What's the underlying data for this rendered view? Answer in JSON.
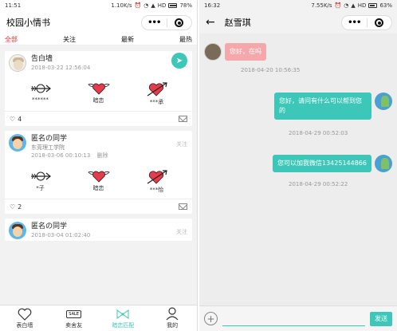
{
  "left": {
    "status": {
      "time": "11:51",
      "speed": "1.10K/s",
      "battery_text": "78%",
      "battery_level": 0.78,
      "network": "HD"
    },
    "title": "校园小情书",
    "tabs": [
      "全部",
      "关注",
      "最新",
      "最热"
    ],
    "cards": [
      {
        "poster": "告白墙",
        "school": "",
        "time": "2018-03-22 12:56:04",
        "delete_label": "",
        "follow_label": "关注",
        "choices": [
          {
            "icon": "arrow-heart-icon",
            "label": "******"
          },
          {
            "icon": "winged-heart-icon",
            "label": "暗恋"
          },
          {
            "icon": "arrow-pierced-heart-icon",
            "label": "***承"
          }
        ],
        "likes": "4"
      },
      {
        "poster": "匿名の同学",
        "school": "东莞理工学院",
        "time": "2018-03-06 00:10:13",
        "delete_label": "删除",
        "follow_label": "关注",
        "choices": [
          {
            "icon": "arrow-heart-icon",
            "label": "*子"
          },
          {
            "icon": "winged-heart-icon",
            "label": "暗恋"
          },
          {
            "icon": "arrow-pierced-heart-icon",
            "label": "***怡"
          }
        ],
        "likes": "2"
      },
      {
        "poster": "匿名の同学",
        "school": "",
        "time": "2018-03-04 01:02:40",
        "delete_label": "",
        "follow_label": "关注"
      }
    ],
    "tabbar": [
      {
        "icon": "heart-outline-icon",
        "label": "表白墙"
      },
      {
        "icon": "sale-tag-icon",
        "label": "卖舍友"
      },
      {
        "icon": "bow-icon",
        "label": "暗恋匹配"
      },
      {
        "icon": "person-icon",
        "label": "我的"
      }
    ]
  },
  "right": {
    "status": {
      "time": "16:32",
      "speed": "7.55K/s",
      "battery_text": "63%",
      "battery_level": 0.63,
      "network": "HD"
    },
    "title": "赵雪琪",
    "messages": [
      {
        "from": "peer",
        "text": "您好，在吗",
        "time": "2018-04-20 10:56:35"
      },
      {
        "from": "self",
        "text": "您好，请问有什么可以帮到您的",
        "time": "2018-04-29 00:52:03"
      },
      {
        "from": "self",
        "text": "您可以加我微信13425144866",
        "time": "2018-04-29 00:52:22"
      }
    ],
    "input_value": "",
    "send_label": "发送"
  },
  "colors": {
    "accent": "#3cc7b8",
    "active_tab": "#e53030",
    "peer_bubble": "#f4a8ac",
    "heart": "#e83a4a"
  }
}
